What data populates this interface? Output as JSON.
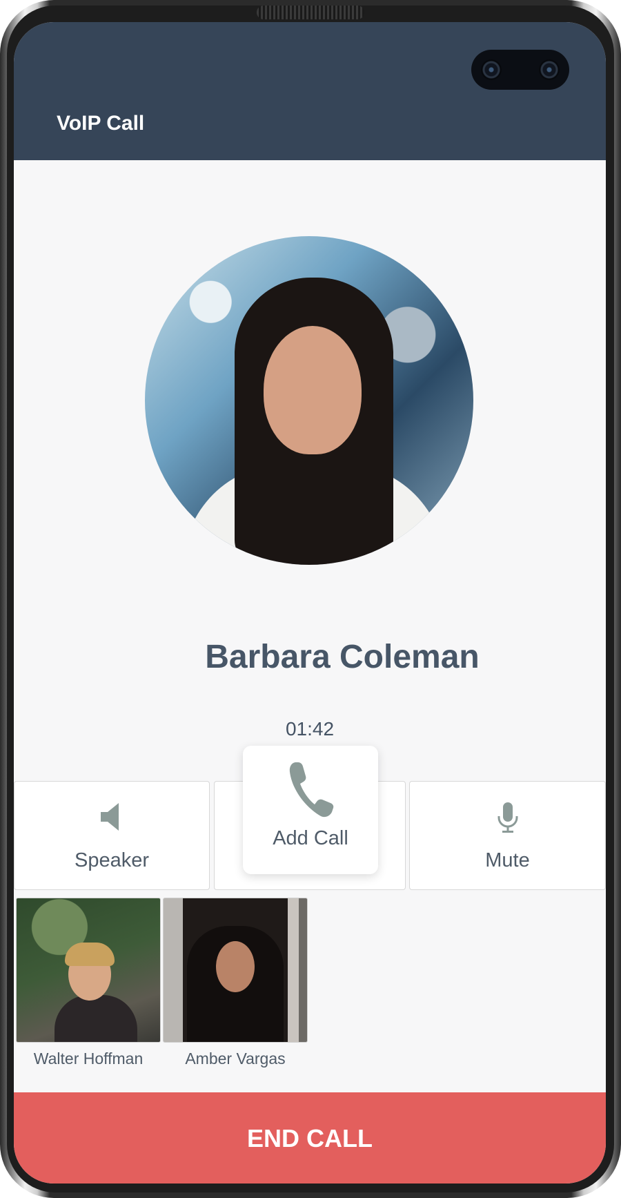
{
  "app_bar": {
    "title": "VoIP Call",
    "color": "#364558"
  },
  "call": {
    "caller_name": "Barbara Coleman",
    "duration": "01:42",
    "avatar_image": "caller-photo"
  },
  "actions": [
    {
      "id": "speaker",
      "label": "Speaker",
      "icon": "speaker-icon"
    },
    {
      "id": "add_call",
      "label": "Add Call",
      "icon": "phone-icon"
    },
    {
      "id": "mute",
      "label": "Mute",
      "icon": "microphone-icon"
    }
  ],
  "contacts": [
    {
      "name": "Walter Hoffman",
      "image": "walter-photo"
    },
    {
      "name": "Amber Vargas",
      "image": "amber-photo"
    }
  ],
  "end_call": {
    "label": "END CALL",
    "color": "#e35f5d"
  },
  "colors": {
    "icon": "#8b9a97",
    "text": "#4f5b68",
    "background": "#f7f7f8"
  }
}
